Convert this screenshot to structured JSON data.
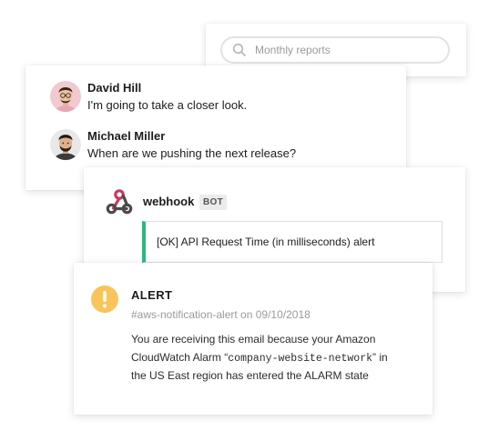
{
  "search": {
    "placeholder": "Monthly reports"
  },
  "messages": [
    {
      "name": "David Hill",
      "text": "I'm going to take a closer look."
    },
    {
      "name": "Michael Miller",
      "text": "When are we pushing the next release?"
    }
  ],
  "webhook": {
    "bot_name": "webhook",
    "badge": "BOT",
    "attachment_text": "[OK]  API Request Time (in milliseconds) alert",
    "attachment_color": "#2eb67d"
  },
  "alert": {
    "title": "ALERT",
    "subtitle": "#aws-notification-alert on 09/10/2018",
    "body": {
      "line1": "You are receiving this email because your Amazon",
      "line2_pre": "CloudWatch Alarm “",
      "alarm_name": "company-website-network",
      "line2_post": "” in",
      "line3_pre": "the US East ",
      "line3_post": " region has entered the ALARM state"
    },
    "icon_color": "#f9c55b"
  },
  "icons": {
    "search": "search-icon",
    "webhook": "webhook-icon",
    "alert": "exclamation-icon"
  }
}
